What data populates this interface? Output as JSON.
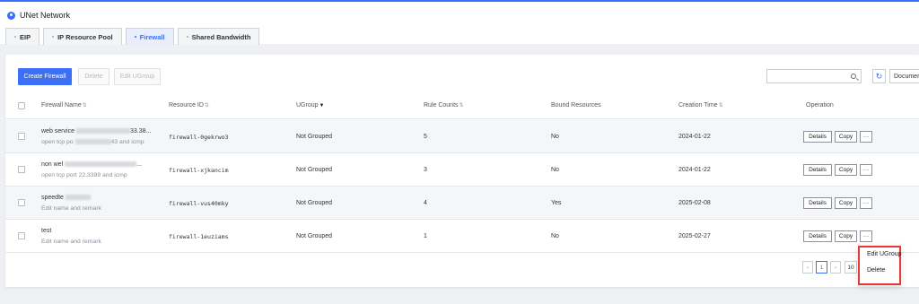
{
  "app": {
    "title": "UNet Network"
  },
  "tabs": [
    {
      "label": "EIP"
    },
    {
      "label": "IP Resource Pool"
    },
    {
      "label": "Firewall"
    },
    {
      "label": "Shared Bandwidth"
    }
  ],
  "toolbar": {
    "create_label": "Create Firewall",
    "delete_label": "Delete",
    "edit_ugroup_label": "Edit UGroup",
    "search_placeholder": "",
    "doc_label": "Documer"
  },
  "table": {
    "headers": {
      "name": "Firewall Name",
      "resource_id": "Resource ID",
      "ugroup": "UGroup",
      "rule_counts": "Rule Counts",
      "bound": "Bound Resources",
      "creation": "Creation Time",
      "operation": "Operation"
    },
    "rows": [
      {
        "name": "web service",
        "name_tail": "33.38...",
        "remark": "open tcp po",
        "remark_tail": "43 and icmp",
        "resource_id": "firewall-0gekrwo3",
        "ugroup": "Not Grouped",
        "rule_counts": "5",
        "bound": "No",
        "creation": "2024-01-22"
      },
      {
        "name": "non wel",
        "name_tail": "...",
        "remark": "open tcp port 22,3389 and icmp",
        "remark_tail": "",
        "resource_id": "firewall-xjkancim",
        "ugroup": "Not Grouped",
        "rule_counts": "3",
        "bound": "No",
        "creation": "2024-01-22"
      },
      {
        "name": "speedte",
        "name_tail": "",
        "remark": "Edit name and remark",
        "remark_tail": "",
        "resource_id": "firewall-vus40mky",
        "ugroup": "Not Grouped",
        "rule_counts": "4",
        "bound": "Yes",
        "creation": "2025-02-08"
      },
      {
        "name": "test",
        "name_tail": "",
        "remark": "Edit name and remark",
        "remark_tail": "",
        "resource_id": "firewall-1euziams",
        "ugroup": "Not Grouped",
        "rule_counts": "1",
        "bound": "No",
        "creation": "2025-02-27"
      }
    ],
    "ops": {
      "details": "Details",
      "copy": "Copy",
      "more": "···"
    }
  },
  "pagination": {
    "prev": "‹",
    "current": "1",
    "next": "›",
    "size": "10"
  },
  "dropdown": {
    "items": [
      "Edit UGroup",
      "Delete"
    ]
  },
  "colors": {
    "accent": "#3b6ff5",
    "highlight": "#e53935"
  }
}
